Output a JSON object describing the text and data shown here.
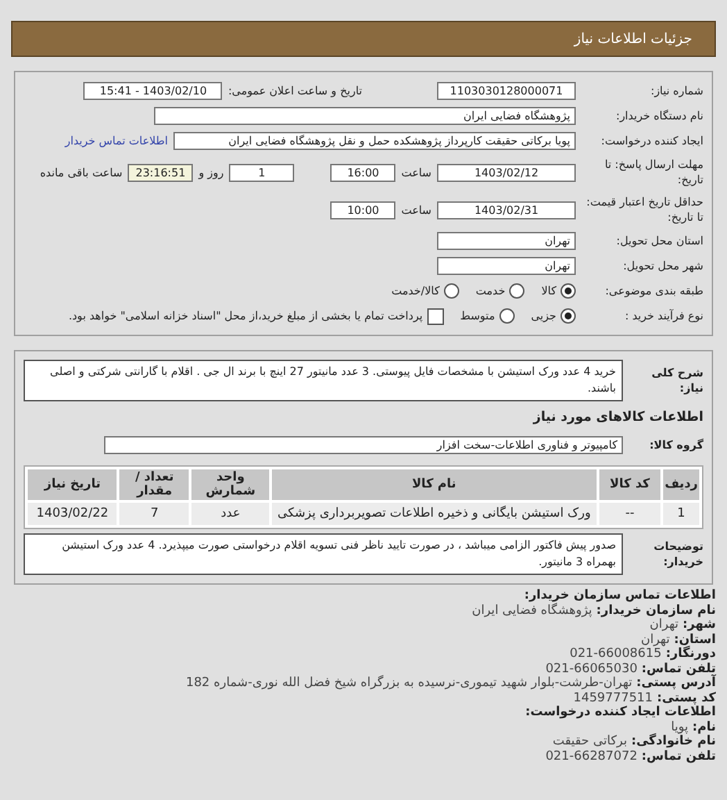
{
  "header": {
    "title": "جزئیات اطلاعات نیاز"
  },
  "details": {
    "need_number": {
      "label": "شماره نیاز:",
      "value": "1103030128000071"
    },
    "announce": {
      "label": "تاریخ و ساعت اعلان عمومی:",
      "value": "1403/02/10 - 15:41"
    },
    "buyer": {
      "label": "نام دستگاه خریدار:",
      "value": "پژوهشگاه فضایی ایران"
    },
    "creator": {
      "label": "ایجاد کننده درخواست:",
      "value": "پویا برکاتی حقیقت کارپرداز پژوهشکده حمل و نقل پژوهشگاه فضایی ایران",
      "link": "اطلاعات تماس خریدار"
    },
    "deadline": {
      "label": "مهلت ارسال پاسخ: تا تاریخ:",
      "date": "1403/02/12",
      "time_label": "ساعت",
      "time": "16:00",
      "days": "1",
      "days_label": "روز و",
      "remaining": "23:16:51",
      "remaining_label": "ساعت باقی مانده"
    },
    "validity": {
      "label": "حداقل تاریخ اعتبار قیمت: تا تاریخ:",
      "date": "1403/02/31",
      "time_label": "ساعت",
      "time": "10:00"
    },
    "province": {
      "label": "استان محل تحویل:",
      "value": "تهران"
    },
    "city": {
      "label": "شهر محل تحویل:",
      "value": "تهران"
    },
    "category": {
      "label": "طبقه بندی موضوعی:",
      "options": [
        {
          "label": "کالا",
          "selected": true
        },
        {
          "label": "خدمت",
          "selected": false
        },
        {
          "label": "کالا/خدمت",
          "selected": false
        }
      ]
    },
    "process": {
      "label": "نوع فرآیند خرید :",
      "options": [
        {
          "label": "جزیی",
          "selected": true
        },
        {
          "label": "متوسط",
          "selected": false
        }
      ],
      "treasury": {
        "label": "پرداخت تمام یا بخشی از مبلغ خرید،از محل \"اسناد خزانه اسلامی\" خواهد بود.",
        "checked": false
      }
    }
  },
  "needs": {
    "summary": {
      "label": "شرح کلی نیاز:",
      "text": "خرید 4 عدد ورک استیشن با مشخصات فایل پیوستی. 3 عدد مانیتور 27 اینچ با برند ال جی . اقلام با گارانتی شرکتی و اصلی باشند."
    },
    "goods_title": "اطلاعات کالاهای مورد نیاز",
    "goods_group": {
      "label": "گروه کالا:",
      "value": "کامپیوتر و فناوری اطلاعات-سخت افزار"
    },
    "table": {
      "columns": [
        "ردیف",
        "کد کالا",
        "نام کالا",
        "واحد شمارش",
        "تعداد / مقدار",
        "تاریخ نیاز"
      ],
      "rows": [
        [
          "1",
          "--",
          "ورک استیشن بایگانی و ذخیره اطلاعات تصویربرداری پزشکی",
          "عدد",
          "7",
          "1403/02/22"
        ]
      ]
    },
    "buyer_notes": {
      "label": "توضیحات خریدار:",
      "text": "صدور پیش فاکتور الزامی میباشد ، در صورت تایید ناظر فنی تسویه اقلام درخواستی صورت میپذیرد. 4 عدد ورک استیشن بهمراه 3 مانیتور."
    }
  },
  "buyer_contact": {
    "title": "اطلاعات تماس سازمان خریدار:",
    "lines": [
      {
        "label": "نام سازمان خریدار:",
        "value": "پژوهشگاه فضایی ایران"
      },
      {
        "label": "شهر:",
        "value": "تهران"
      },
      {
        "label": "استان:",
        "value": "تهران"
      },
      {
        "label": "دورنگار:",
        "value": "021-66008615"
      },
      {
        "label": "تلفن تماس:",
        "value": "021-66065030"
      },
      {
        "label": "آدرس پستی:",
        "value": "تهران-طرشت-بلوار شهید تیموری-نرسیده به بزرگراه شیخ فضل الله نوری-شماره 182"
      },
      {
        "label": "کد پستی:",
        "value": "1459777511"
      }
    ]
  },
  "creator_contact": {
    "title": "اطلاعات ایجاد کننده درخواست:",
    "lines": [
      {
        "label": "نام:",
        "value": "پویا"
      },
      {
        "label": "نام خانوادگی:",
        "value": "برکاتی حقیقت"
      },
      {
        "label": "تلفن تماس:",
        "value": "021-66287072"
      }
    ]
  }
}
